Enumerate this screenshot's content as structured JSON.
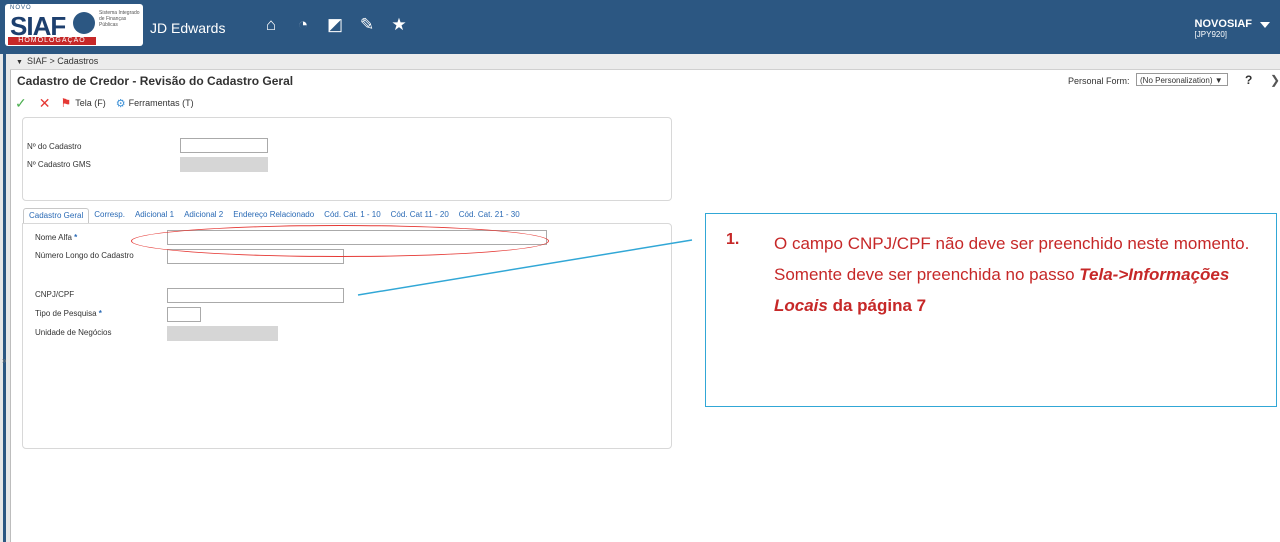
{
  "header": {
    "logo": {
      "novo": "NOVO",
      "siaf": "SIAF",
      "system": "Sistema Integrado de Finanças Públicas",
      "env": "HOMOLOGAÇÃO"
    },
    "product": "JD Edwards",
    "user": {
      "name": "NOVOSIAF",
      "env": "[JPY920]"
    },
    "accent": "#2c5782"
  },
  "breadcrumb": {
    "root": "SIAF",
    "sep": ">",
    "item": "Cadastros"
  },
  "form": {
    "title": "Cadastro de Credor - Revisão do Cadastro Geral",
    "personal_form_label": "Personal Form:",
    "personal_form_value": "(No Personalization)",
    "help": "?",
    "close": "X"
  },
  "toolbar": {
    "tela": "Tela (F)",
    "ferramentas": "Ferramentas (T)"
  },
  "header_fields": {
    "cadastro_label": "Nº do Cadastro",
    "cadastro_gms_label": "Nº Cadastro GMS"
  },
  "tabs": [
    "Cadastro Geral",
    "Corresp.",
    "Adicional 1",
    "Adicional 2",
    "Endereço Relacionado",
    "Cód. Cat. 1 - 10",
    "Cód. Cat 11 - 20",
    "Cód. Cat. 21 - 30"
  ],
  "fields": {
    "nome_alfa": "Nome Alfa",
    "numero_longo": "Número Longo do Cadastro",
    "cnpj": "CNPJ/CPF",
    "tipo_pesquisa": "Tipo de Pesquisa",
    "unidade": "Unidade de Negócios",
    "required_mark": "*"
  },
  "annotation": {
    "number": "1.",
    "text_a": "O campo CNPJ/CPF não deve ser preenchido neste momento. Somente deve ser preenchida no passo ",
    "text_b": "Tela->Informações Locais",
    "text_c": " da página 7",
    "color": "#c62828",
    "border_color": "#31a7d6"
  }
}
